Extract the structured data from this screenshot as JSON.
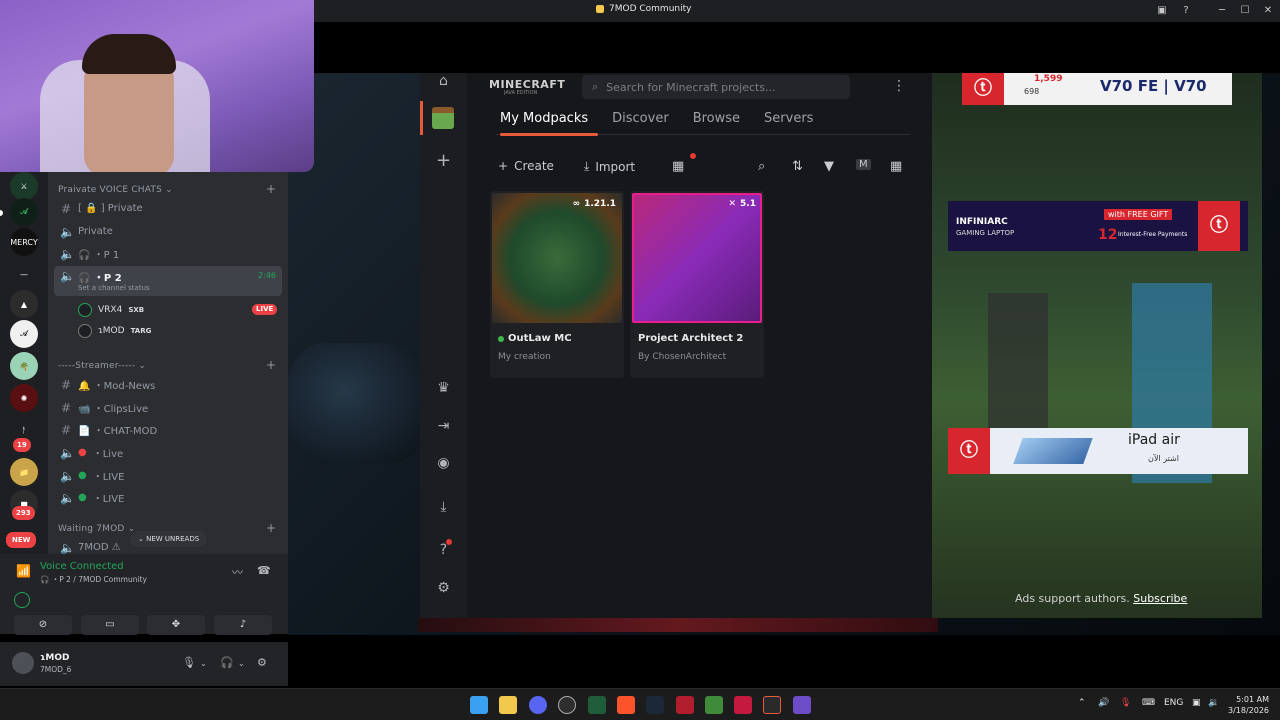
{
  "window": {
    "title": "7MOD Community"
  },
  "discord": {
    "categories": [
      {
        "label": "Praivate VOICE CHATS"
      },
      {
        "label": "-----Streamer-----"
      },
      {
        "label": "Waiting 7MOD"
      }
    ],
    "channels_private": [
      {
        "label": "[ 🔒 ] Private"
      },
      {
        "label": "Private"
      },
      {
        "label": "🎧 ・P 1"
      },
      {
        "label": "🎧 ・P 2",
        "time": "2:46",
        "status": "Set a channel status"
      }
    ],
    "voice_users": [
      {
        "name": "VRX4",
        "tag": "SXB",
        "live": "LIVE"
      },
      {
        "name": "ɿMOD",
        "tag": "TARG"
      }
    ],
    "channels_streamer": [
      {
        "label": "🔔 ・Mod-News"
      },
      {
        "label": "📹 ・ClipsLive"
      },
      {
        "label": "📄 ・CHAT-MOD"
      },
      {
        "label": "・Live"
      },
      {
        "label": "・LIVE"
      },
      {
        "label": "・LIVE"
      }
    ],
    "channels_waiting": [
      {
        "label": "7MOD ⚠"
      }
    ],
    "new_unreads": "NEW UNREADS",
    "rail_badges": {
      "b1": "19",
      "b2": "293",
      "new": "NEW"
    },
    "voice_panel": {
      "title": "Voice Connected",
      "subtitle": "🎧 ・P 2 / 7MOD Community"
    },
    "user": {
      "name": "ɿMOD",
      "status": "7MOD_6"
    }
  },
  "launcher": {
    "logo": "MINECRAFT",
    "logo_sub": "JAVA EDITION",
    "search_placeholder": "Search for Minecraft projects...",
    "tabs": [
      "My Modpacks",
      "Discover",
      "Browse",
      "Servers"
    ],
    "active_tab": "My Modpacks",
    "toolbar": {
      "create": "Create",
      "import": "Import"
    },
    "cards": [
      {
        "name": "OutLaw MC",
        "version": "1.21.1",
        "by": "My creation"
      },
      {
        "name": "Project Architect 2",
        "version": "5.1",
        "by": "By ChosenArchitect"
      }
    ]
  },
  "ads": {
    "ad1": {
      "price": "1,599",
      "price2": "698",
      "text": "V70 FE | V70"
    },
    "ad2": {
      "brand": "INFINIARC",
      "sub": "GAMING LAPTOP",
      "gift": "with FREE GIFT",
      "months": "12",
      "payments": "Interest-Free Payments"
    },
    "ad3": {
      "text": "iPad air",
      "sub": "اشتر الآن"
    },
    "support": "Ads support authors.",
    "subscribe": "Subscribe"
  },
  "taskbar": {
    "lang": "ENG",
    "time": "5:01 AM",
    "date": "3/18/2026"
  },
  "colors": {
    "accent": "#e85b3a",
    "discord_green": "#23a559",
    "live_red": "#ed4245"
  }
}
